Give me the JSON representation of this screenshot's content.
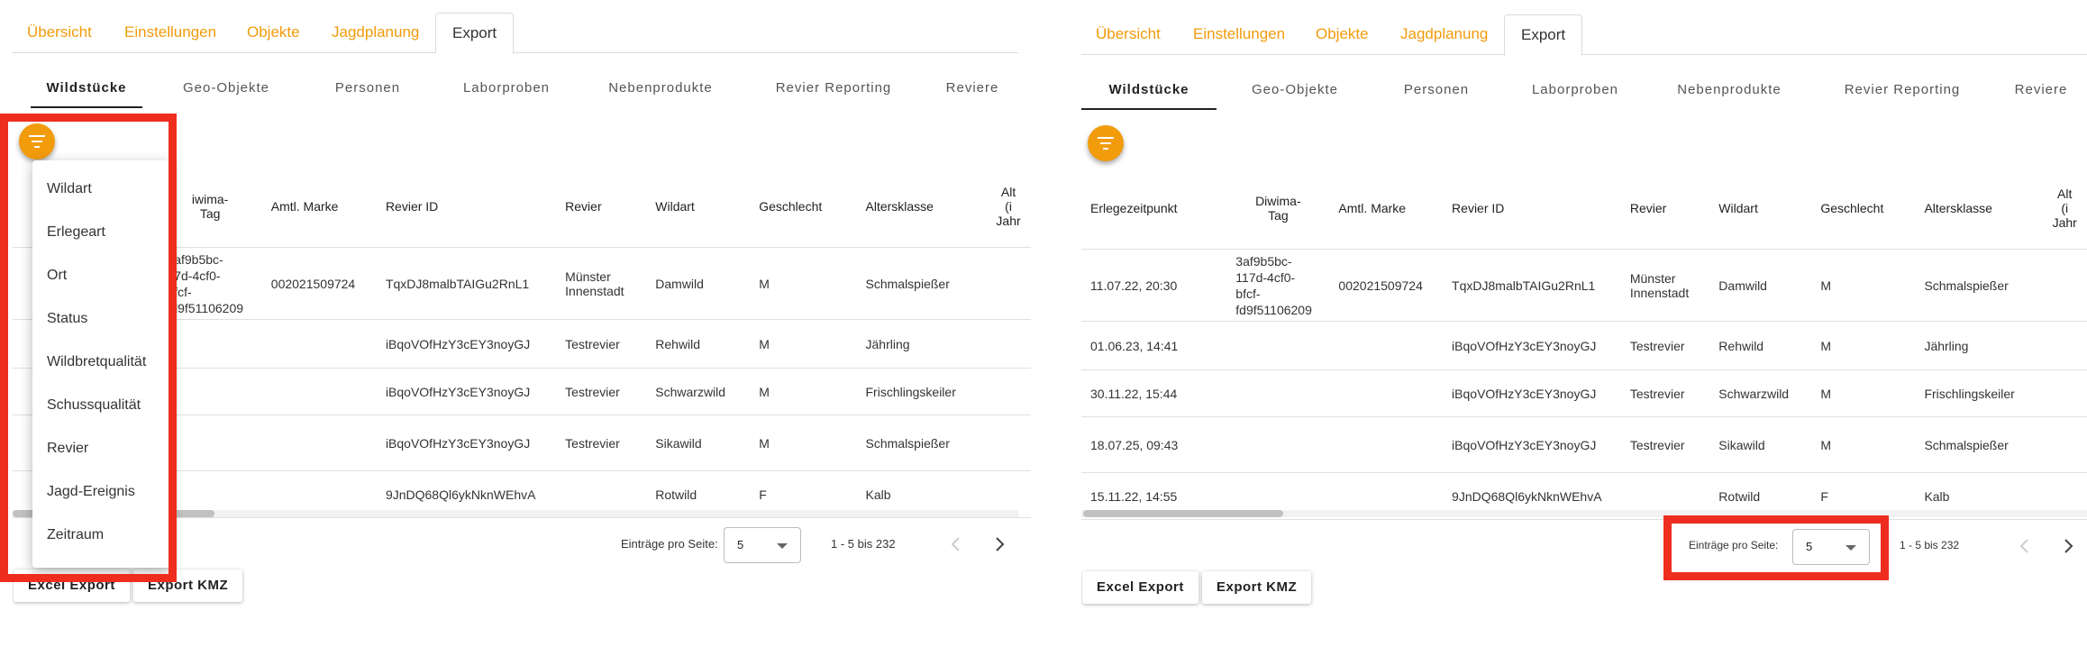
{
  "top_tabs": [
    "Übersicht",
    "Einstellungen",
    "Objekte",
    "Jagdplanung",
    "Export"
  ],
  "sub_tabs": [
    "Wildstücke",
    "Geo-Objekte",
    "Personen",
    "Laborproben",
    "Nebenprodukte",
    "Revier Reporting",
    "Reviere"
  ],
  "accent_color": "#f29b0b",
  "highlight_color": "#ee2d1f",
  "filter_menu": [
    "Wildart",
    "Erlegeart",
    "Ort",
    "Status",
    "Wildbretqualität",
    "Schussqualität",
    "Revier",
    "Jagd-Ereignis",
    "Zeitraum"
  ],
  "table": {
    "headers": [
      "Erlegezeitpunkt",
      "Diwima-Tag",
      "Amtl. Marke",
      "Revier ID",
      "Revier",
      "Wildart",
      "Geschlecht",
      "Altersklasse",
      "Alter (in Jahren)"
    ],
    "left_headers": {
      "diwima_partial": "iwima-\nTag",
      "alter_partial": "Alt\n(i\nJahr"
    },
    "right_headers": {
      "diwima": "Diwima-\nTag",
      "alter_partial": "Alt\n(i\nJahr"
    },
    "rows": [
      {
        "zeit": "11.07.22, 20:30",
        "diwima": "3af9b5bc-\n117d-4cf0-\nbfcf-\nfd9f51106209",
        "diwima_partial": "3af9b5bc-\n17d-4cf0-\nbfcf-\nfd9f51106209",
        "marke": "002021509724",
        "revier_id": "TqxDJ8malbTAIGu2RnL1",
        "revier": "Münster\nInnenstadt",
        "wildart": "Damwild",
        "geschlecht": "M",
        "alter": "Schmalspießer"
      },
      {
        "zeit": "01.06.23, 14:41",
        "diwima": "",
        "diwima_partial": "",
        "marke": "",
        "revier_id": "iBqoVOfHzY3cEY3noyGJ",
        "revier": "Testrevier",
        "wildart": "Rehwild",
        "geschlecht": "M",
        "alter": "Jährling"
      },
      {
        "zeit": "30.11.22, 15:44",
        "diwima": "",
        "diwima_partial": "",
        "marke": "",
        "revier_id": "iBqoVOfHzY3cEY3noyGJ",
        "revier": "Testrevier",
        "wildart": "Schwarzwild",
        "geschlecht": "M",
        "alter": "Frischlingskeiler"
      },
      {
        "zeit": "18.07.25, 09:43",
        "diwima": "",
        "diwima_partial": "",
        "marke": "",
        "revier_id": "iBqoVOfHzY3cEY3noyGJ",
        "revier": "Testrevier",
        "wildart": "Sikawild",
        "geschlecht": "M",
        "alter": "Schmalspießer"
      },
      {
        "zeit": "15.11.22, 14:55",
        "diwima": "",
        "diwima_partial": "",
        "marke": "",
        "revier_id": "9JnDQ68Ql6ykNknWEhvA",
        "revier": "",
        "wildart": "Rotwild",
        "geschlecht": "F",
        "alter": "Kalb"
      }
    ]
  },
  "pagination": {
    "label": "Einträge pro Seite:",
    "page_size": "5",
    "range": "1 - 5 bis 232"
  },
  "buttons": {
    "excel": "Excel Export",
    "kmz": "Export KMZ"
  }
}
